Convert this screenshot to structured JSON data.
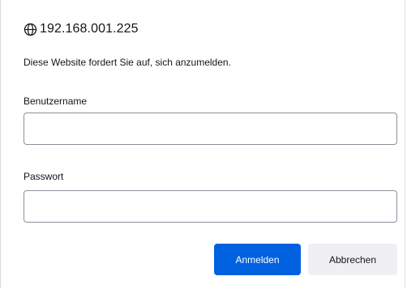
{
  "dialog": {
    "origin": "192.168.001.225",
    "origin_icon": "globe-icon",
    "message": "Diese Website fordert Sie auf, sich anzumelden.",
    "username_label": "Benutzername",
    "username_value": "",
    "password_label": "Passwort",
    "password_value": "",
    "login_label": "Anmelden",
    "cancel_label": "Abbrechen"
  },
  "colors": {
    "primary_button": "#0061e0",
    "secondary_button": "#f0f0f4",
    "text": "#15141a",
    "field_border": "#8f8f9d"
  }
}
